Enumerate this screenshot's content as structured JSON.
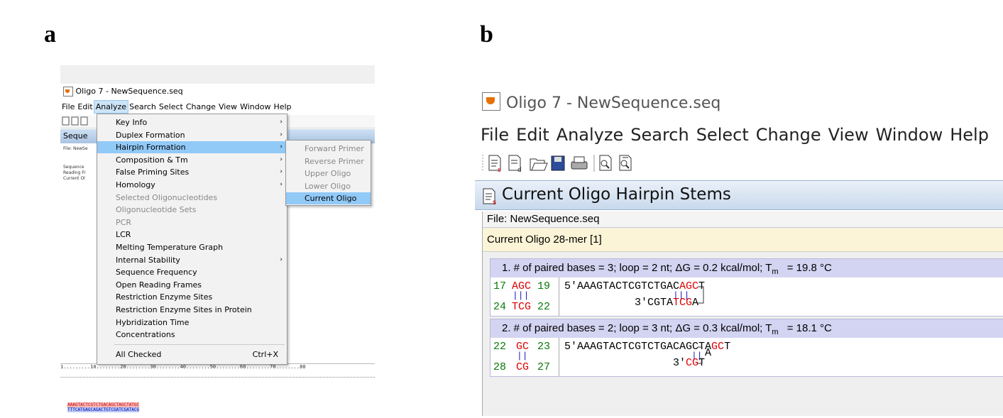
{
  "labels": {
    "a": "a",
    "b": "b"
  },
  "panel_a": {
    "title": "Oligo 7 - NewSequence.seq",
    "menubar": [
      "File",
      "Edit",
      "Analyze",
      "Search",
      "Select",
      "Change",
      "View",
      "Window",
      "Help"
    ],
    "inner_title": "Seque",
    "inner_rows": [
      "File: NewSe",
      "Sequence",
      "Reading Fr",
      "Current Ol"
    ],
    "menu": [
      {
        "label": "Key Info",
        "arrow": true,
        "disabled": false
      },
      {
        "label": "Duplex Formation",
        "arrow": true,
        "disabled": false
      },
      {
        "label": "Hairpin Formation",
        "arrow": true,
        "disabled": false,
        "selected": true
      },
      {
        "label": "Composition & Tm",
        "arrow": true,
        "disabled": false
      },
      {
        "label": "False Priming Sites",
        "arrow": true,
        "disabled": false
      },
      {
        "label": "Homology",
        "arrow": true,
        "disabled": false
      },
      {
        "label": "Selected Oligonucleotides",
        "arrow": false,
        "disabled": true
      },
      {
        "label": "Oligonucleotide Sets",
        "arrow": false,
        "disabled": true
      },
      {
        "label": "PCR",
        "arrow": false,
        "disabled": true
      },
      {
        "label": "LCR",
        "arrow": false,
        "disabled": false
      },
      {
        "label": "Melting Temperature Graph",
        "arrow": false,
        "disabled": false
      },
      {
        "label": "Internal Stability",
        "arrow": true,
        "disabled": false
      },
      {
        "label": "Sequence Frequency",
        "arrow": false,
        "disabled": false
      },
      {
        "label": "Open Reading Frames",
        "arrow": false,
        "disabled": false
      },
      {
        "label": "Restriction Enzyme Sites",
        "arrow": false,
        "disabled": false
      },
      {
        "label": "Restriction Enzyme Sites in Protein",
        "arrow": false,
        "disabled": false
      },
      {
        "label": "Hybridization Time",
        "arrow": false,
        "disabled": false
      },
      {
        "label": "Concentrations",
        "arrow": false,
        "disabled": false
      }
    ],
    "menu_last": {
      "label": "All Checked",
      "shortcut": "Ctrl+X"
    },
    "submenu": [
      {
        "label": "Forward Primer",
        "selected": false
      },
      {
        "label": "Reverse Primer",
        "selected": false
      },
      {
        "label": "Upper Oligo",
        "selected": false
      },
      {
        "label": "Lower Oligo",
        "selected": false
      },
      {
        "label": "Current Oligo",
        "selected": true
      }
    ],
    "ruler": "1.........10........20........30........40........50........60........70........80",
    "seq_top": "AAAGTACTCGTCTGACAGCTAGCTATGC",
    "seq_bottom": "TTTCATGAGCAGACTGTCGATCGATACG"
  },
  "panel_b": {
    "title": "Oligo 7 - NewSequence.seq",
    "menubar": [
      "File",
      "Edit",
      "Analyze",
      "Search",
      "Select",
      "Change",
      "View",
      "Window",
      "Help"
    ],
    "window_title": "Current Oligo Hairpin Stems",
    "file_line": "File: NewSequence.seq",
    "oligo_line": "Current Oligo 28-mer [1]",
    "hairpins": [
      {
        "header_pre": "1. # of paired bases = 3; loop = 2 nt; ΔG = 0.2 kcal/mol; T",
        "header_sub": "m",
        "header_post": " = 19.8 °C",
        "top_num_l": "17",
        "top_stem": "AGC",
        "top_num_r": "19",
        "bot_num_l": "24",
        "bot_stem": "TCG",
        "bot_num_r": "22",
        "bars": "|||",
        "seq_top_pre": "5'AAAGTACTCGTCTGAC",
        "seq_top_stem": "AGC",
        "seq_top_post": "T",
        "seq_bot_pre": "3'CGTA",
        "seq_bot_stem": "TCG",
        "seq_bot_post": "A",
        "loop_char": ""
      },
      {
        "header_pre": "2. # of paired bases = 2; loop = 3 nt; ΔG = 0.3 kcal/mol; T",
        "header_sub": "m",
        "header_post": " = 18.1 °C",
        "top_num_l": "22",
        "top_stem": "GC",
        "top_num_r": "23",
        "bot_num_l": "28",
        "bot_stem": "CG",
        "bot_num_r": "27",
        "bars": "||",
        "seq_top_pre": "5'AAAGTACTCGTCTGACAGCTA",
        "seq_top_stem": "GC",
        "seq_top_post": "T",
        "seq_bot_pre": "3'",
        "seq_bot_stem": "CG",
        "seq_bot_post": "T",
        "loop_char": "A"
      }
    ]
  }
}
